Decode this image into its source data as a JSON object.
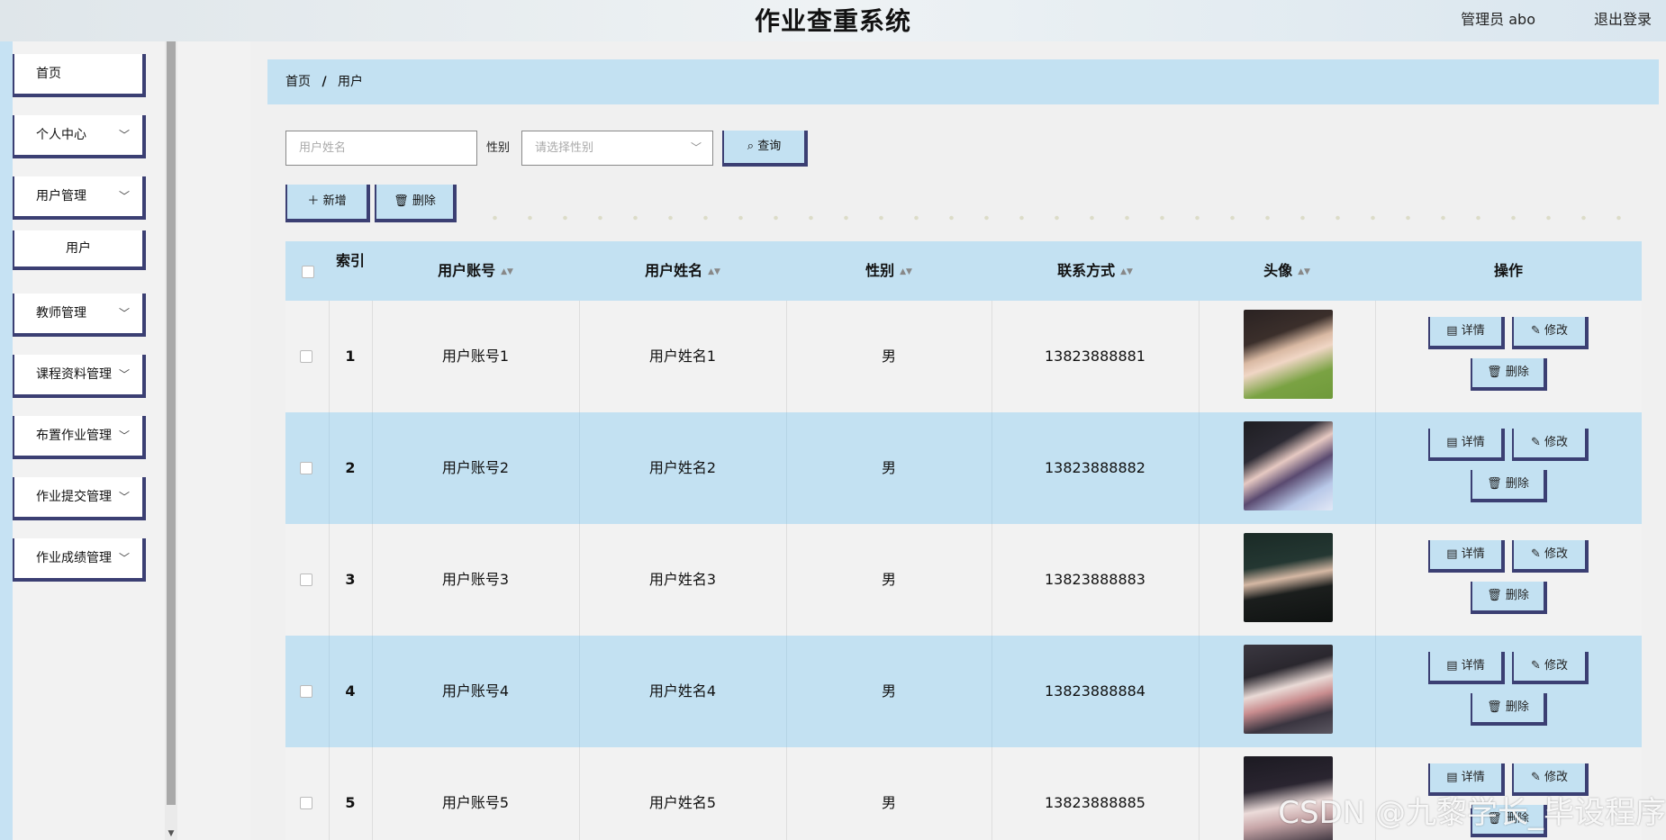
{
  "header": {
    "title": "作业查重系统",
    "admin_label": "管理员 abo",
    "logout_label": "退出登录"
  },
  "sidebar": {
    "items": [
      {
        "label": "首页",
        "has_chevron": false
      },
      {
        "label": "个人中心",
        "has_chevron": true
      },
      {
        "label": "用户管理",
        "has_chevron": true
      },
      {
        "label": "用户",
        "has_chevron": false,
        "sub": true
      },
      {
        "label": "教师管理",
        "has_chevron": true
      },
      {
        "label": "课程资料管理",
        "has_chevron": true
      },
      {
        "label": "布置作业管理",
        "has_chevron": true
      },
      {
        "label": "作业提交管理",
        "has_chevron": true
      },
      {
        "label": "作业成绩管理",
        "has_chevron": true
      }
    ]
  },
  "breadcrumb": {
    "home": "首页",
    "separator": "/",
    "current": "用户"
  },
  "filters": {
    "name_placeholder": "用户姓名",
    "gender_label": "性别",
    "gender_placeholder": "请选择性别",
    "query_label": "查询"
  },
  "toolbar": {
    "add_label": "新增",
    "delete_label": "删除"
  },
  "table": {
    "headers": {
      "index": "索引",
      "account": "用户账号",
      "name": "用户姓名",
      "gender": "性别",
      "phone": "联系方式",
      "avatar": "头像",
      "actions": "操作"
    },
    "rows": [
      {
        "index": "1",
        "account": "用户账号1",
        "name": "用户姓名1",
        "gender": "男",
        "phone": "13823888881"
      },
      {
        "index": "2",
        "account": "用户账号2",
        "name": "用户姓名2",
        "gender": "男",
        "phone": "13823888882"
      },
      {
        "index": "3",
        "account": "用户账号3",
        "name": "用户姓名3",
        "gender": "男",
        "phone": "13823888883"
      },
      {
        "index": "4",
        "account": "用户账号4",
        "name": "用户姓名4",
        "gender": "男",
        "phone": "13823888884"
      },
      {
        "index": "5",
        "account": "用户账号5",
        "name": "用户姓名5",
        "gender": "男",
        "phone": "13823888885"
      }
    ],
    "row_actions": {
      "detail": "详情",
      "edit": "修改",
      "delete": "删除"
    }
  },
  "watermark": "CSDN @九黎学长_毕设程序",
  "colors": {
    "accent_blue": "#c3e1f2",
    "border_navy": "#3b3f73"
  }
}
